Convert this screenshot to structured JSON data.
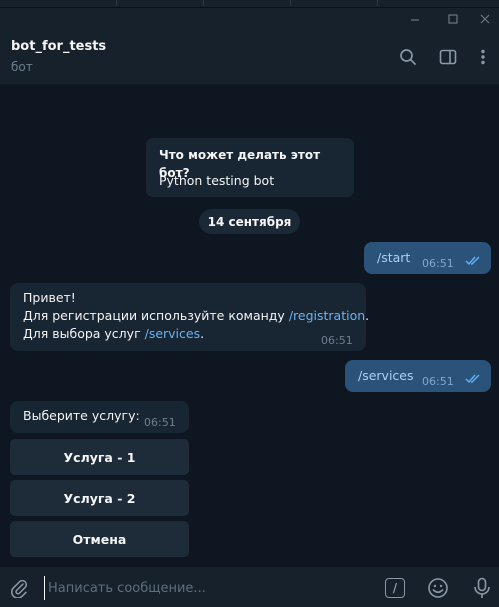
{
  "window": {
    "minimize": "—",
    "maximize": "☐",
    "close": "✕"
  },
  "header": {
    "title": "bot_for_tests",
    "subtitle": "бот"
  },
  "bot_info": {
    "title": "Что может делать этот бот?",
    "description": "Python testing bot"
  },
  "date_separator": "14 сентября",
  "messages": [
    {
      "text": "/start",
      "time": "06:51"
    },
    {
      "line1": "Привет!",
      "line2_prefix": "Для регистрации используйте команду ",
      "line2_link": "/registration",
      "line2_suffix": ".",
      "line3_prefix": "Для выбора услуг ",
      "line3_link": "/services",
      "line3_suffix": ".",
      "time": "06:51"
    },
    {
      "text": "/services",
      "time": "06:51"
    },
    {
      "text": "Выберите услугу:",
      "time": "06:51"
    }
  ],
  "keyboard": [
    "Услуга - 1",
    "Услуга - 2",
    "Отмена"
  ],
  "composer": {
    "placeholder": "Написать сообщение...",
    "commands_label": "/"
  },
  "colors": {
    "background": "#0e1621",
    "panel": "#17212b",
    "incoming": "#182533",
    "outgoing": "#2b5278",
    "link": "#6ab3f3"
  },
  "icons": [
    "search-icon",
    "sidebar-toggle-icon",
    "more-vertical-icon",
    "attach-icon",
    "commands-icon",
    "emoji-icon",
    "microphone-icon",
    "double-check-icon"
  ]
}
